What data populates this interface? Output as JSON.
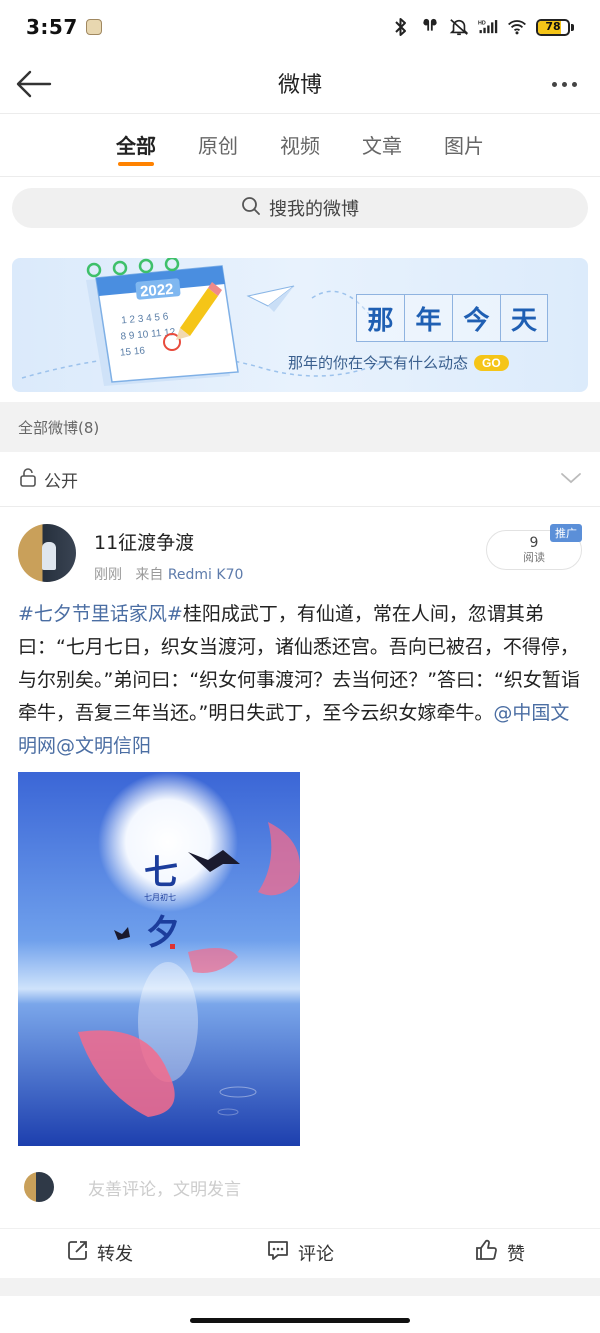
{
  "status_bar": {
    "time": "3:57",
    "battery": "78",
    "battery_level": 0.78
  },
  "nav": {
    "title": "微博"
  },
  "tabs": [
    {
      "label": "全部",
      "active": true
    },
    {
      "label": "原创",
      "active": false
    },
    {
      "label": "视频",
      "active": false
    },
    {
      "label": "文章",
      "active": false
    },
    {
      "label": "图片",
      "active": false
    }
  ],
  "search": {
    "placeholder": "搜我的微博"
  },
  "banner": {
    "calendar_year": "2022",
    "title_chars": [
      "那",
      "年",
      "今",
      "天"
    ],
    "subtitle": "那年的你在今天有什么动态",
    "go_label": "GO"
  },
  "section": {
    "header": "全部微博(8)"
  },
  "visibility": {
    "label": "公开"
  },
  "post": {
    "username": "11征渡争渡",
    "time": "刚刚",
    "source_prefix": "来自",
    "source": "Redmi K70",
    "reads_count": "9",
    "reads_label": "阅读",
    "ad_tag": "推广",
    "hashtag": "#七夕节里话家风#",
    "body": "桂阳成武丁，有仙道，常在人间，忽谓其弟曰：“七月七日，织女当渡河，诸仙悉还宫。吾向已被召，不得停，与尔别矣。”弟问曰：“织女何事渡河？去当何还？”答曰：“织女暂诣牵牛，吾复三年当还。”明日失武丁，至今云织女嫁牵牛。",
    "mention_1": "@中国文明网",
    "mention_2": "@文明信阳",
    "image": {
      "char_1": "七",
      "char_2": "夕",
      "small_text": "七月初七"
    }
  },
  "comment": {
    "placeholder": "友善评论，文明发言"
  },
  "actions": {
    "repost": "转发",
    "comment": "评论",
    "like": "赞"
  },
  "colors": {
    "accent": "#ff8200",
    "link": "#4b6ea3",
    "ad_badge": "#5b8fd8",
    "battery": "#f5c518"
  }
}
